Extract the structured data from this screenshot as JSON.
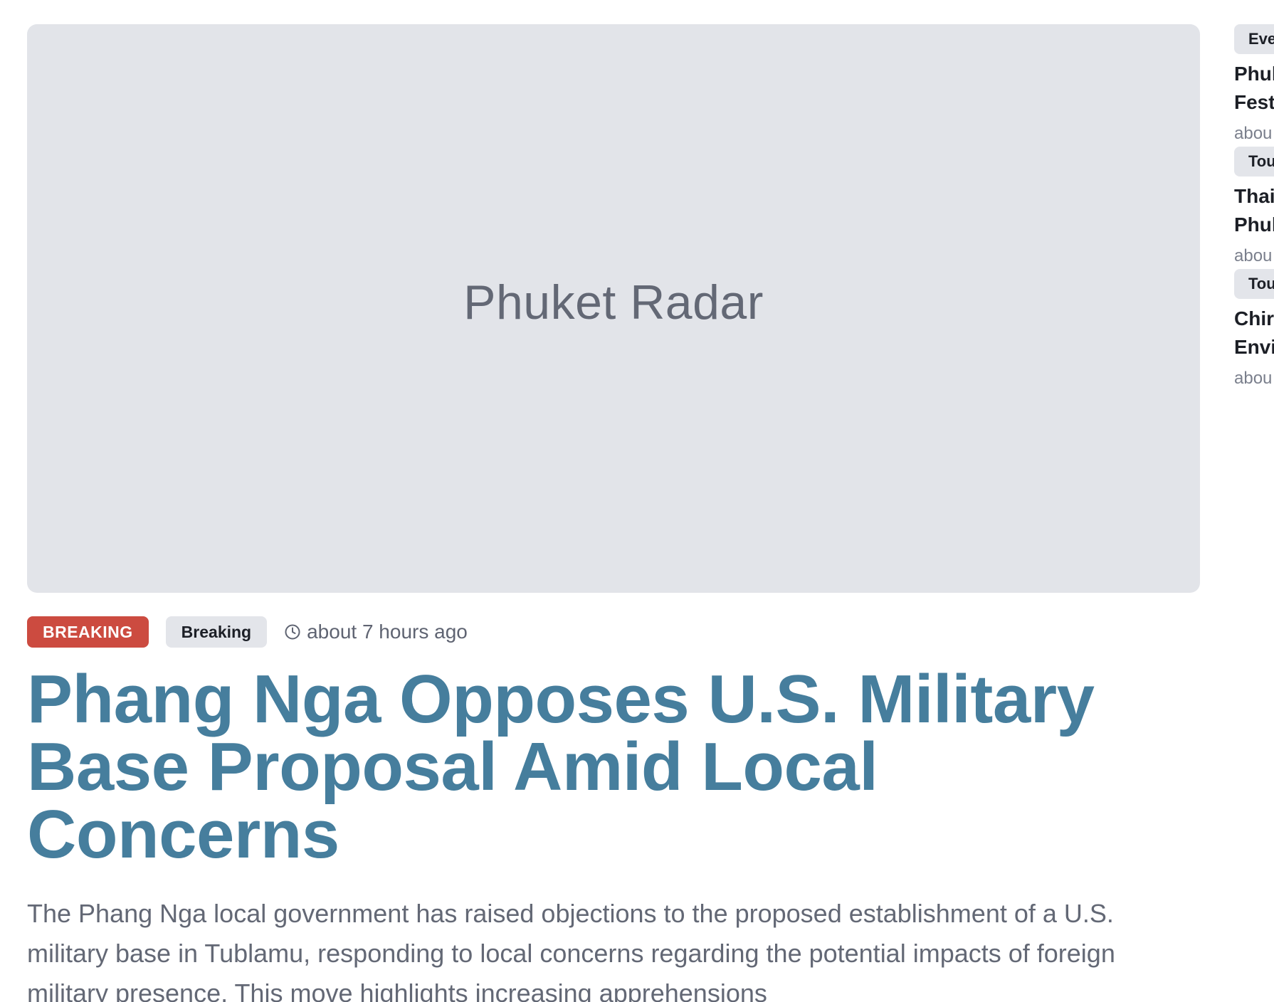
{
  "hero": {
    "placeholder_label": "Phuket Radar"
  },
  "article": {
    "breaking_badge": "BREAKING",
    "category": "Breaking",
    "timestamp": "about 7 hours ago",
    "headline": "Phang Nga Opposes U.S. Military Base Proposal Amid Local Concerns",
    "summary": "The Phang Nga local government has raised objections to the proposed establishment of a U.S. military base in Tublamu, responding to local concerns regarding the potential impacts of foreign military presence. This move highlights increasing apprehensions"
  },
  "sidebar": {
    "items": [
      {
        "tag": "Eve",
        "title_line1": "Phul",
        "title_line2": "Fest",
        "time": "abou"
      },
      {
        "tag": "Tou",
        "title_line1": "Thai",
        "title_line2": "Phul",
        "time": "abou"
      },
      {
        "tag": "Tou",
        "title_line1": "Chir",
        "title_line2": "Envi",
        "time": "abou"
      }
    ]
  },
  "icons": {
    "clock": "clock-icon"
  },
  "colors": {
    "breaking_badge": "#cc4b40",
    "headline": "#467e9d",
    "hero_background": "#e2e4e9"
  }
}
